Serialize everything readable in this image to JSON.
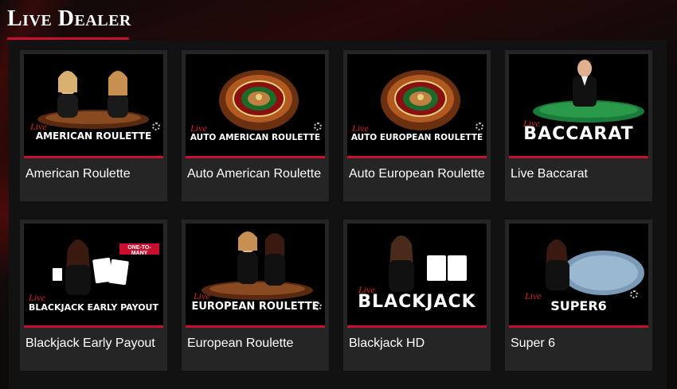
{
  "header": {
    "title": "Live Dealer"
  },
  "colors": {
    "accent": "#c8102e",
    "card_bg": "#252525",
    "panel_bg": "#121212"
  },
  "games": [
    {
      "title": "American Roulette",
      "thumb_live": "Live",
      "thumb_name": "AMERICAN ROULETTE",
      "art": "dealers-roulette"
    },
    {
      "title": "Auto American Roulette",
      "thumb_live": "Live",
      "thumb_name": "AUTO AMERICAN ROULETTE",
      "art": "roulette-wheel"
    },
    {
      "title": "Auto European Roulette",
      "thumb_live": "Live",
      "thumb_name": "AUTO EUROPEAN ROULETTE",
      "art": "roulette-wheel"
    },
    {
      "title": "Live Baccarat",
      "thumb_live": "Live",
      "thumb_name": "BACCARAT",
      "art": "dealer-table"
    },
    {
      "title": "Blackjack Early Payout",
      "thumb_live": "Live",
      "thumb_name": "BLACKJACK EARLY PAYOUT",
      "thumb_badge": "ONE-TO-MANY",
      "art": "dealer-cards"
    },
    {
      "title": "European Roulette",
      "thumb_live": "Live",
      "thumb_name": "EUROPEAN ROULETTE",
      "art": "dealers-roulette"
    },
    {
      "title": "Blackjack HD",
      "thumb_live": "Live",
      "thumb_name": "BLACKJACK",
      "art": "dealer-cards"
    },
    {
      "title": "Super 6",
      "thumb_live": "Live",
      "thumb_name": "SUPER6",
      "art": "dealer-table"
    }
  ]
}
